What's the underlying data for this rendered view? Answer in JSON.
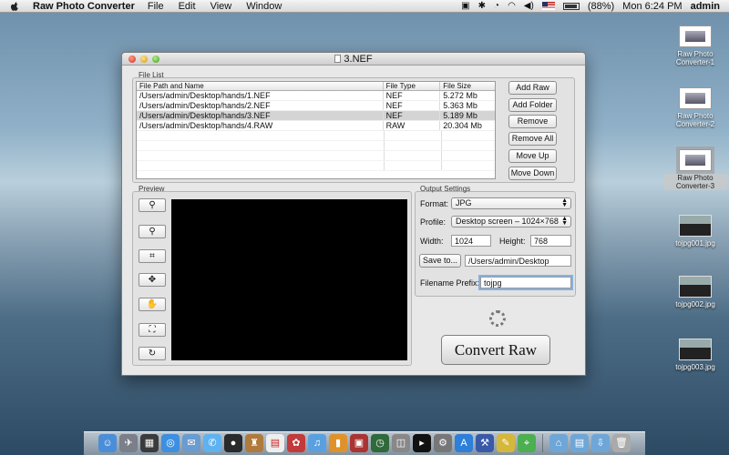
{
  "menubar": {
    "app_name": "Raw Photo Converter",
    "menus": [
      "File",
      "Edit",
      "View",
      "Window"
    ],
    "battery": "(88%)",
    "clock": "Mon 6:24 PM",
    "user": "admin"
  },
  "window": {
    "title": "3.NEF"
  },
  "file_list": {
    "group_label": "File List",
    "columns": [
      "File Path and Name",
      "File Type",
      "File Size"
    ],
    "rows": [
      {
        "path": "/Users/admin/Desktop/hands/1.NEF",
        "type": "NEF",
        "size": "5.272 Mb"
      },
      {
        "path": "/Users/admin/Desktop/hands/2.NEF",
        "type": "NEF",
        "size": "5.363 Mb"
      },
      {
        "path": "/Users/admin/Desktop/hands/3.NEF",
        "type": "NEF",
        "size": "5.189 Mb"
      },
      {
        "path": "/Users/admin/Desktop/hands/4.RAW",
        "type": "RAW",
        "size": "20.304 Mb"
      }
    ],
    "selected_row": 2,
    "buttons": {
      "add_raw": "Add Raw",
      "add_folder": "Add Folder",
      "remove": "Remove",
      "remove_all": "Remove All",
      "move_up": "Move Up",
      "move_down": "Move Down"
    }
  },
  "preview": {
    "group_label": "Preview"
  },
  "output": {
    "group_label": "Output Settings",
    "format_label": "Format:",
    "format_value": "JPG",
    "profile_label": "Profile:",
    "profile_value": "Desktop screen – 1024×768",
    "width_label": "Width:",
    "width_value": "1024",
    "height_label": "Height:",
    "height_value": "768",
    "save_button": "Save to...",
    "save_path": "/Users/admin/Desktop",
    "prefix_label": "Filename Prefix:",
    "prefix_value": "tojpg",
    "convert_button": "Convert Raw"
  },
  "desktop_icons": [
    {
      "label": "Raw Photo Converter-1"
    },
    {
      "label": "Raw Photo Converter-2"
    },
    {
      "label": "Raw Photo Converter-3"
    },
    {
      "label": "tojpg001.jpg"
    },
    {
      "label": "tojpg002.jpg"
    },
    {
      "label": "tojpg003.jpg"
    }
  ],
  "colors": {
    "selection_row": "#d4d4d4",
    "focus_ring": "#86b1e3",
    "preview_bg": "#000000"
  }
}
